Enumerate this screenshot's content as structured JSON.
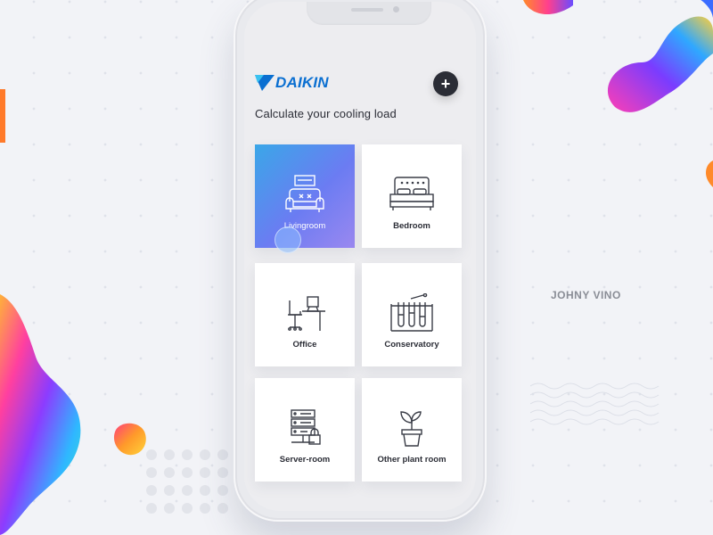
{
  "brand": {
    "name": "DAIKIN",
    "color": "#0a6fd1"
  },
  "header": {
    "add_button_label": "+",
    "title": "Calculate your cooling load"
  },
  "rooms": [
    {
      "label": "Livingroom",
      "icon": "sofa-icon",
      "selected": true
    },
    {
      "label": "Bedroom",
      "icon": "bed-icon",
      "selected": false
    },
    {
      "label": "Office",
      "icon": "desk-chair-icon",
      "selected": false
    },
    {
      "label": "Conservatory",
      "icon": "test-tubes-icon",
      "selected": false
    },
    {
      "label": "Server-room",
      "icon": "server-lock-icon",
      "selected": false
    },
    {
      "label": "Other plant room",
      "icon": "potted-plant-icon",
      "selected": false
    }
  ],
  "colors": {
    "accent_gradient_start": "#3aa7e8",
    "accent_gradient_end": "#9a88f0",
    "dark_button": "#2b2d36"
  },
  "author_credit": "JOHNY VINO"
}
